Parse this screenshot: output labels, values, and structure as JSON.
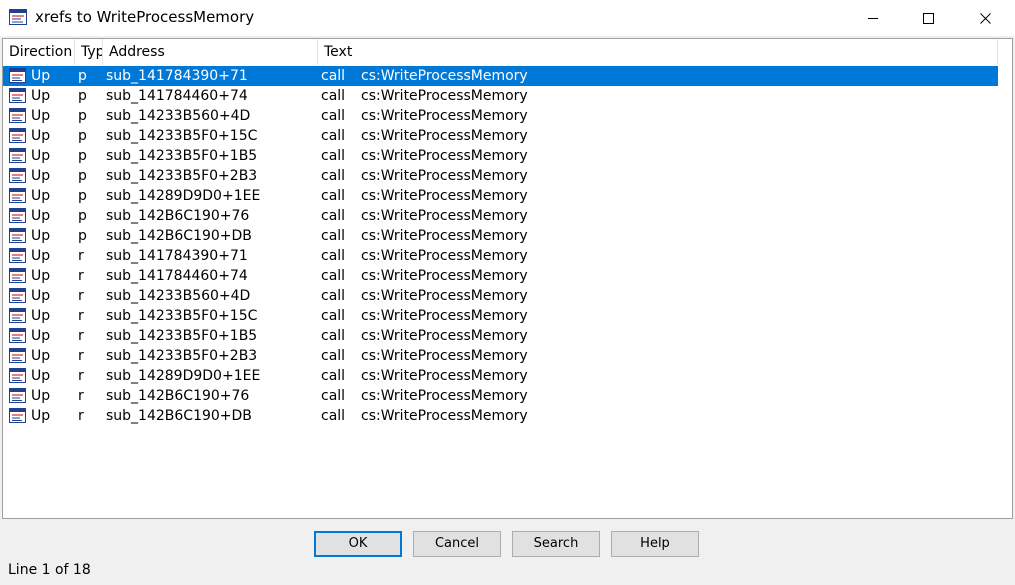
{
  "window": {
    "title": "xrefs to WriteProcessMemory"
  },
  "columns": {
    "direction": "Direction",
    "type": "Typ",
    "address": "Address",
    "text": "Text"
  },
  "rows": [
    {
      "direction": "Up",
      "type": "p",
      "address": "sub_141784390+71",
      "instr": "call",
      "operand": "cs:WriteProcessMemory",
      "selected": true
    },
    {
      "direction": "Up",
      "type": "p",
      "address": "sub_141784460+74",
      "instr": "call",
      "operand": "cs:WriteProcessMemory"
    },
    {
      "direction": "Up",
      "type": "p",
      "address": "sub_14233B560+4D",
      "instr": "call",
      "operand": "cs:WriteProcessMemory"
    },
    {
      "direction": "Up",
      "type": "p",
      "address": "sub_14233B5F0+15C",
      "instr": "call",
      "operand": "cs:WriteProcessMemory"
    },
    {
      "direction": "Up",
      "type": "p",
      "address": "sub_14233B5F0+1B5",
      "instr": "call",
      "operand": "cs:WriteProcessMemory"
    },
    {
      "direction": "Up",
      "type": "p",
      "address": "sub_14233B5F0+2B3",
      "instr": "call",
      "operand": "cs:WriteProcessMemory"
    },
    {
      "direction": "Up",
      "type": "p",
      "address": "sub_14289D9D0+1EE",
      "instr": "call",
      "operand": "cs:WriteProcessMemory"
    },
    {
      "direction": "Up",
      "type": "p",
      "address": "sub_142B6C190+76",
      "instr": "call",
      "operand": "cs:WriteProcessMemory"
    },
    {
      "direction": "Up",
      "type": "p",
      "address": "sub_142B6C190+DB",
      "instr": "call",
      "operand": "cs:WriteProcessMemory"
    },
    {
      "direction": "Up",
      "type": "r",
      "address": "sub_141784390+71",
      "instr": "call",
      "operand": "cs:WriteProcessMemory"
    },
    {
      "direction": "Up",
      "type": "r",
      "address": "sub_141784460+74",
      "instr": "call",
      "operand": "cs:WriteProcessMemory"
    },
    {
      "direction": "Up",
      "type": "r",
      "address": "sub_14233B560+4D",
      "instr": "call",
      "operand": "cs:WriteProcessMemory"
    },
    {
      "direction": "Up",
      "type": "r",
      "address": "sub_14233B5F0+15C",
      "instr": "call",
      "operand": "cs:WriteProcessMemory"
    },
    {
      "direction": "Up",
      "type": "r",
      "address": "sub_14233B5F0+1B5",
      "instr": "call",
      "operand": "cs:WriteProcessMemory"
    },
    {
      "direction": "Up",
      "type": "r",
      "address": "sub_14233B5F0+2B3",
      "instr": "call",
      "operand": "cs:WriteProcessMemory"
    },
    {
      "direction": "Up",
      "type": "r",
      "address": "sub_14289D9D0+1EE",
      "instr": "call",
      "operand": "cs:WriteProcessMemory"
    },
    {
      "direction": "Up",
      "type": "r",
      "address": "sub_142B6C190+76",
      "instr": "call",
      "operand": "cs:WriteProcessMemory"
    },
    {
      "direction": "Up",
      "type": "r",
      "address": "sub_142B6C190+DB",
      "instr": "call",
      "operand": "cs:WriteProcessMemory"
    }
  ],
  "buttons": {
    "ok": "OK",
    "cancel": "Cancel",
    "search": "Search",
    "help": "Help"
  },
  "status": {
    "line": "Line 1 of 18"
  },
  "icons": {
    "app": "xref-window-icon",
    "row": "xref-row-icon"
  },
  "colors": {
    "selection": "#0078d7"
  }
}
